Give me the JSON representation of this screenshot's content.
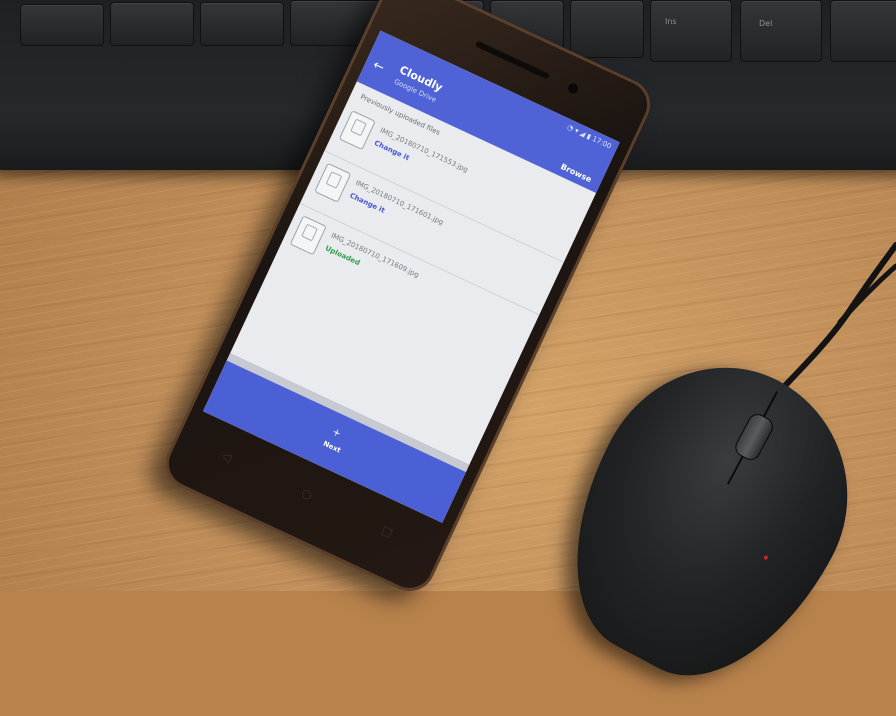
{
  "scene": {
    "description_objects": [
      "smartphone",
      "computer-keyboard",
      "computer-mouse",
      "wooden-desk"
    ]
  },
  "keyboard": {
    "key_legends": [
      "Ins",
      "Del"
    ]
  },
  "phone": {
    "status_bar": {
      "icons": "◔ ▾ ◢ ▮ 17:00"
    },
    "app_bar": {
      "back_icon": "arrow-left-icon",
      "title": "Cloudly",
      "subtitle": "Google Drive",
      "action_label": "Browse"
    },
    "section_header": "Previously uploaded files",
    "files": [
      {
        "name": "IMG_20180710_171553.jpg",
        "status": "Change it",
        "status_color": "#4656d1"
      },
      {
        "name": "IMG_20180710_171601.jpg",
        "status": "Change it",
        "status_color": "#4656d1"
      },
      {
        "name": "IMG_20180710_171609.jpg",
        "status": "Uploaded",
        "status_color": "#33a04b"
      }
    ],
    "footer": {
      "icon": "plus-icon",
      "label": "Next"
    },
    "nav_buttons": [
      "back-nav-icon",
      "home-nav-icon",
      "recents-nav-icon"
    ],
    "accent_color": "#4f63d7"
  }
}
